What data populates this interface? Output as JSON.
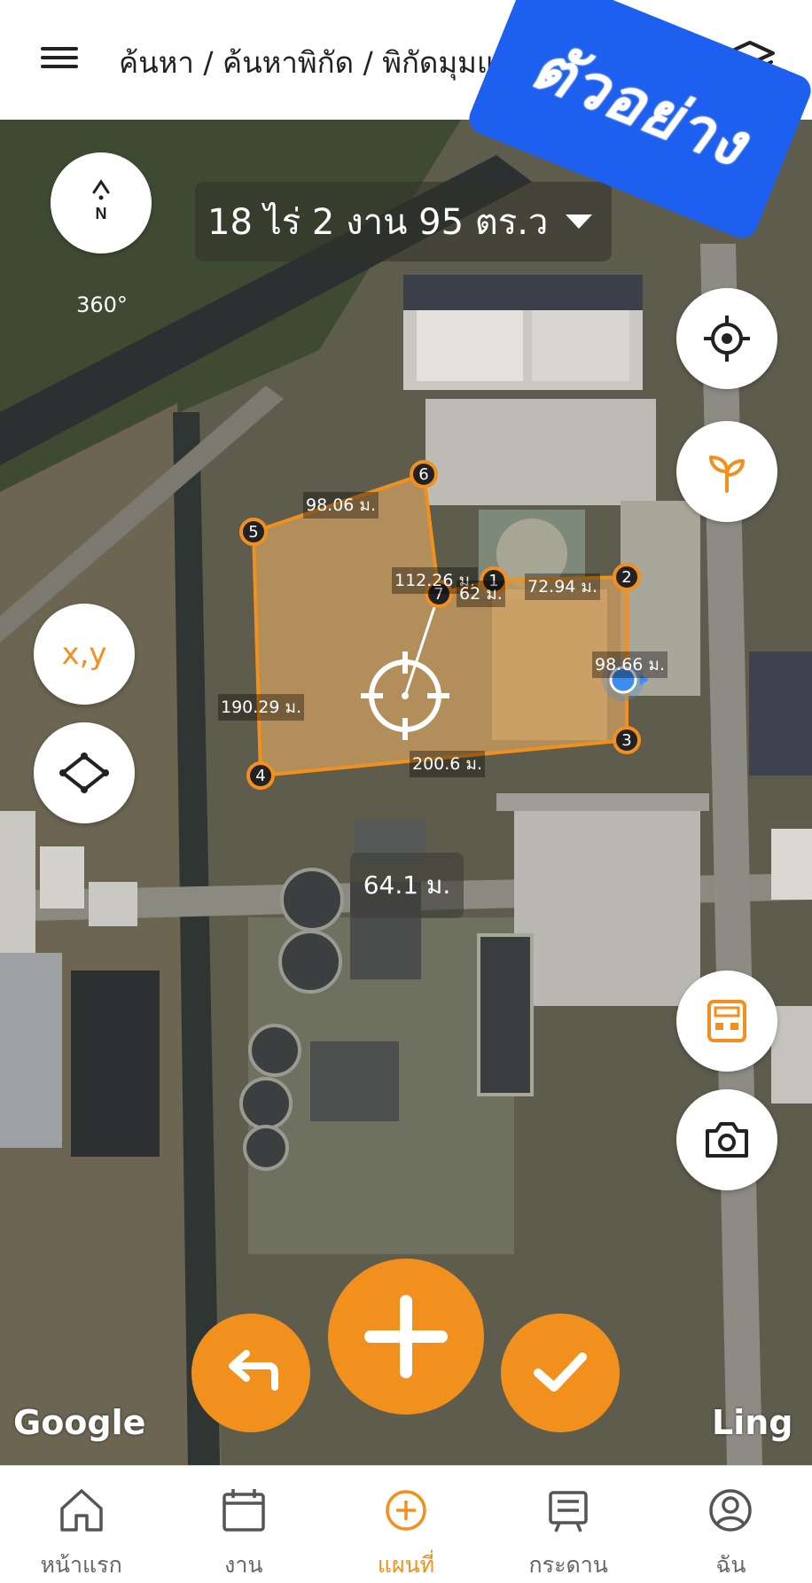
{
  "header": {
    "breadcrumb": "ค้นหา / ค้นหาพิกัด / พิกัดมุมแปลง"
  },
  "watermark": "ตัวอย่าง",
  "map": {
    "area_text": "18 ไร่ 2 งาน 95 ตร.ว",
    "compass_label": "360°",
    "compass_letter": "N",
    "xy_label": "x,y",
    "distance_label": "64.1 ม.",
    "brand_left": "Google",
    "brand_right": "Ling",
    "vertex_labels": [
      "1",
      "2",
      "3",
      "4",
      "5",
      "6",
      "7"
    ],
    "edge_labels": {
      "e56": "98.06 ม.",
      "e67": "112.26 ม.",
      "e54": "190.29 ม.",
      "e71": "62 ม.",
      "e12": "72.94 ม.",
      "e23": "98.66 ม.",
      "e34": "200.6 ม."
    }
  },
  "bottom_nav": [
    {
      "label": "หน้าแรก",
      "icon": "home-icon"
    },
    {
      "label": "งาน",
      "icon": "calendar-icon"
    },
    {
      "label": "แผนที่",
      "icon": "add-circle-icon"
    },
    {
      "label": "กระดาน",
      "icon": "board-icon"
    },
    {
      "label": "ฉัน",
      "icon": "user-icon"
    }
  ],
  "colors": {
    "accent": "#f2901e",
    "watermark": "#1d5fee"
  }
}
